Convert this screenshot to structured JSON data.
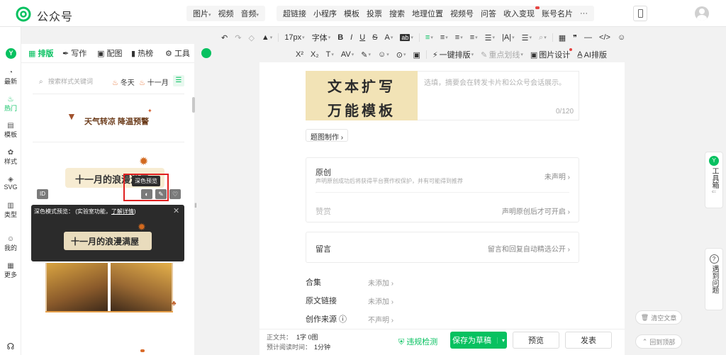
{
  "brand": "公众号",
  "topmenu": {
    "group1": [
      {
        "label": "图片",
        "caret": true
      },
      {
        "label": "视频",
        "caret": false
      },
      {
        "label": "音频",
        "caret": true
      }
    ],
    "group2": [
      {
        "label": "超链接",
        "dot": false
      },
      {
        "label": "小程序",
        "dot": false
      },
      {
        "label": "模板",
        "dot": false
      },
      {
        "label": "投票",
        "dot": false
      },
      {
        "label": "搜索",
        "dot": false
      },
      {
        "label": "地理位置",
        "dot": false
      },
      {
        "label": "视频号",
        "dot": false
      },
      {
        "label": "问答",
        "dot": false
      },
      {
        "label": "收入变现",
        "dot": true
      },
      {
        "label": "账号名片",
        "dot": true
      },
      {
        "label": "···",
        "dot": false
      }
    ]
  },
  "toolbar1": [
    "↶",
    "↷",
    "◇",
    "▲",
    "17px",
    "字体",
    "B",
    "I",
    "U",
    "S",
    "A",
    "ab",
    "≡",
    "≡",
    "≡",
    "≡",
    "☰",
    "|A|",
    "☰",
    "⌕",
    "▦",
    "❞",
    "—",
    "</>",
    "☺"
  ],
  "toolbar2": [
    "X²",
    "X₂",
    "T",
    "AV",
    "✎",
    "☺",
    "⊙",
    "▣",
    "一键排版",
    "重点划线",
    "图片设计",
    "AI排版"
  ],
  "leftnav": [
    {
      "icon": "◔",
      "label": "最新",
      "active": false
    },
    {
      "icon": "♨",
      "label": "热门",
      "active": true
    },
    {
      "icon": "▤",
      "label": "模板",
      "active": false
    },
    {
      "icon": "✿",
      "label": "样式",
      "active": false
    },
    {
      "icon": "◈",
      "label": "SVG",
      "active": false
    },
    {
      "icon": "▥",
      "label": "类型",
      "active": false
    },
    {
      "icon": "☺",
      "label": "我的",
      "active": false
    },
    {
      "icon": "▦",
      "label": "更多",
      "active": false
    }
  ],
  "panel_tabs": [
    {
      "label": "排版",
      "icon": "▦",
      "active": true
    },
    {
      "label": "写作",
      "icon": "✒",
      "active": false
    },
    {
      "label": "配图",
      "icon": "▣",
      "active": false
    },
    {
      "label": "热榜",
      "icon": "▮",
      "active": false
    },
    {
      "label": "工具",
      "icon": "⚙",
      "active": false
    }
  ],
  "search_placeholder": "搜索样式关键词",
  "tags": [
    "冬天",
    "十一月"
  ],
  "cards": {
    "banner1": "天气转凉 降温预警",
    "banner2": "十一月的浪漫满屋",
    "id_label": "ID",
    "hover_tooltip": "深色预览"
  },
  "dark_preview": {
    "label": "深色模式预览：",
    "sub": "(实验室功能，",
    "link": "了解详情",
    "close": ")",
    "title": "十一月的浪漫满屋"
  },
  "editor": {
    "cover_line1": "文本扩写",
    "cover_line2": "万能模板",
    "summary_placeholder": "选填，摘要会在转发卡片和公众号会话展示。",
    "counter": "0/120",
    "cover_make": "题图制作 ›",
    "original_title": "原创",
    "original_sub": "声明原创成功后将获得平台赛作权保护，并有可能得到推荐",
    "original_right": "未声明 ›",
    "reward_title": "赞赏",
    "reward_right": "声明原创后才可开启 ›",
    "comment_title": "留言",
    "comment_right": "留言和回复自动精选公开 ›",
    "fields": [
      {
        "label": "合集",
        "value": "未添加 ›"
      },
      {
        "label": "原文链接",
        "value": "未添加 ›"
      },
      {
        "label": "创作来源 ⓘ",
        "value": "不声明 ›"
      }
    ]
  },
  "bottom": {
    "word_count_label": "正文共：",
    "word_count": "1字 0图",
    "read_time_label": "预计阅读时间：",
    "read_time": "1分钟",
    "check": "违规检测",
    "save": "保存为草稿",
    "preview": "预览",
    "publish": "发表"
  },
  "right_float": {
    "toolbox": "工具箱",
    "help": "遇到问题",
    "clear": "清空文章",
    "top": "回到顶部"
  },
  "colors": {
    "accent": "#07c160",
    "danger": "#e64340"
  }
}
